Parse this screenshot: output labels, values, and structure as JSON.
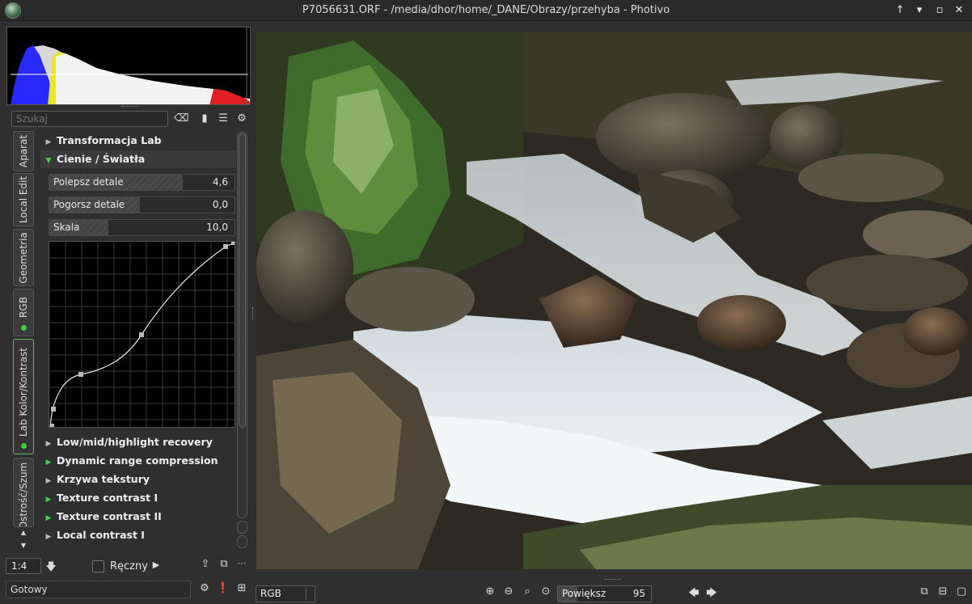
{
  "window": {
    "title": "P7056631.ORF - /media/dhor/home/_DANE/Obrazy/przehyba - Photivo"
  },
  "search": {
    "placeholder": "Szukaj"
  },
  "side_tabs": [
    {
      "label": "Aparat"
    },
    {
      "label": "Local Edit"
    },
    {
      "label": "Geometria"
    },
    {
      "label": "RGB"
    },
    {
      "label": "Lab Kolor/Kontrast"
    },
    {
      "label": "Ostrość/Szum"
    }
  ],
  "sections": {
    "lab_transform": "Transformacja Lab",
    "shadows_highlights": "Cienie / Światła",
    "collapsed": [
      "Low/mid/highlight recovery",
      "Dynamic range compression",
      "Krzywa tekstury",
      "Texture contrast I",
      "Texture contrast II",
      "Local contrast I"
    ]
  },
  "sliders": [
    {
      "label": "Polepsz detale",
      "value": "4,6",
      "fill": 0.72
    },
    {
      "label": "Pogorsz detale",
      "value": "0,0",
      "fill": 0.49
    },
    {
      "label": "Skala",
      "value": "10,0",
      "fill": 0.32
    }
  ],
  "bottom": {
    "zoom_ratio": "1:4",
    "manual_label": "Ręczny",
    "status": "Gotowy",
    "channel": "RGB",
    "zoom_label": "Powiększ",
    "zoom_value": "95"
  }
}
